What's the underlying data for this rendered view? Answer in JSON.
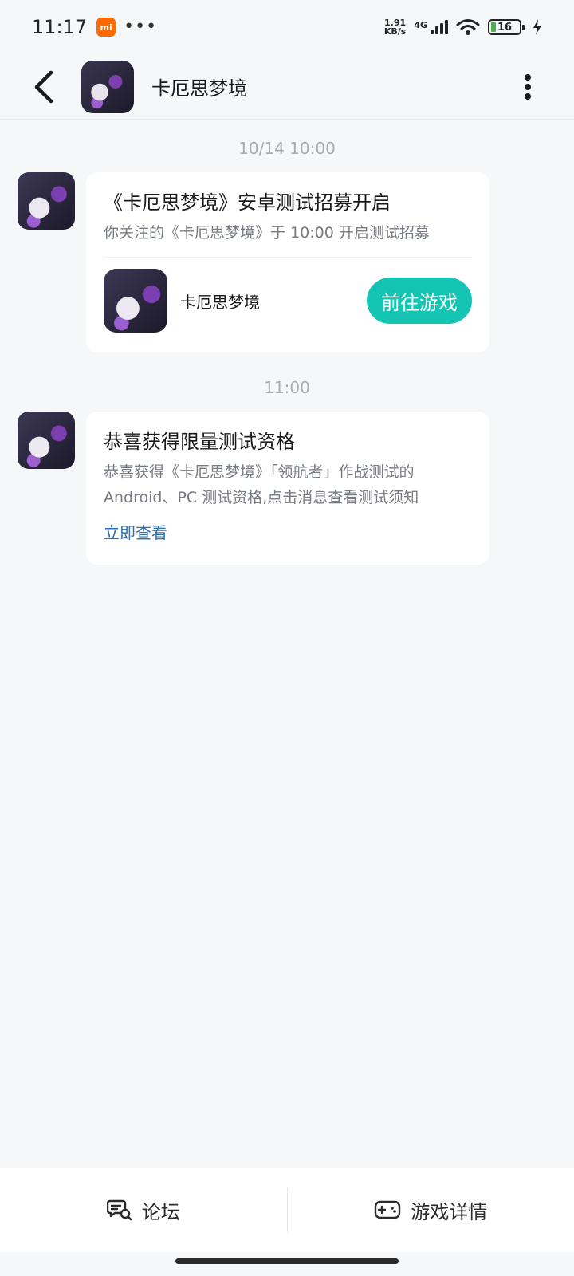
{
  "status_bar": {
    "time": "11:17",
    "speed_top": "1.91",
    "speed_unit": "KB/s",
    "network": "4G",
    "battery": "16",
    "icons": [
      "xiaomi-badge-icon",
      "more-dots-icon",
      "signal-icon",
      "wifi-icon",
      "battery-icon",
      "charging-icon"
    ]
  },
  "header": {
    "title": "卡厄思梦境",
    "back_icon": "chevron-left-icon",
    "more_icon": "vertical-dots-icon"
  },
  "messages": [
    {
      "time": "10/14  10:00",
      "title": "《卡厄思梦境》安卓测试招募开启",
      "desc": "你关注的《卡厄思梦境》于 10:00 开启测试招募",
      "game_name": "卡厄思梦境",
      "button_label": "前往游戏"
    },
    {
      "time": "11:00",
      "title": "恭喜获得限量测试资格",
      "desc_line1": "恭喜获得《卡厄思梦境》「领航者」作战测试的",
      "desc_line2": "Android、PC 测试资格,点击消息查看测试须知",
      "link_label": "立即查看"
    }
  ],
  "bottom_bar": {
    "forum_label": "论坛",
    "details_label": "游戏详情"
  },
  "colors": {
    "accent": "#15c5b4",
    "link": "#2a6fb4",
    "background": "#f6f7f9"
  }
}
